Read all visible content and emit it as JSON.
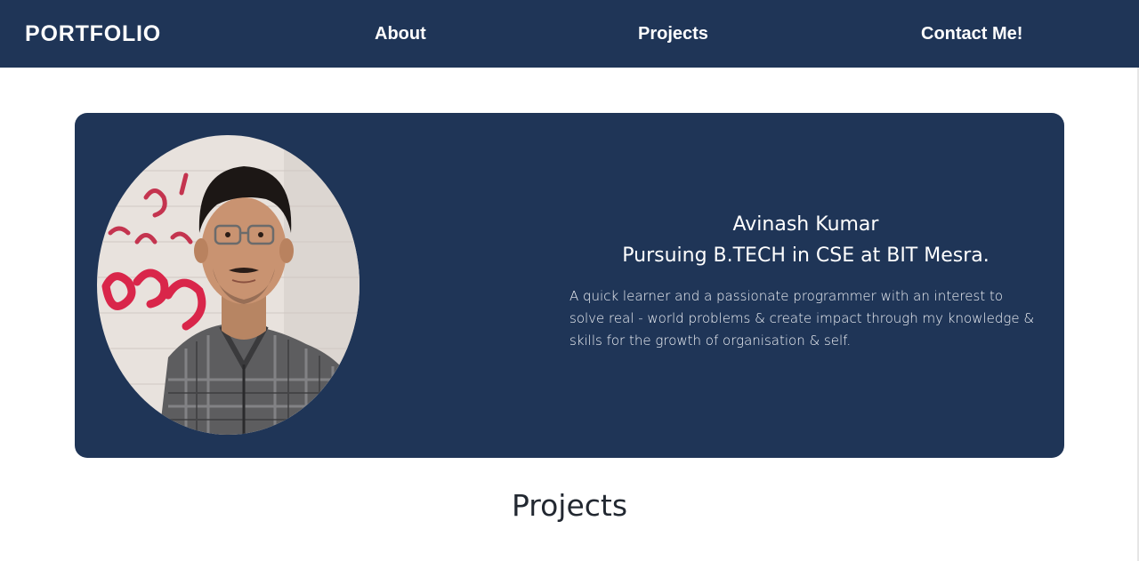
{
  "navbar": {
    "brand": "PORTFOLIO",
    "links": [
      {
        "label": "About"
      },
      {
        "label": "Projects"
      },
      {
        "label": "Contact Me!"
      }
    ],
    "background": "#1f3557"
  },
  "hero": {
    "name": "Avinash Kumar",
    "title": "Pursuing B.TECH in CSE at BIT Mesra.",
    "bio": "A quick learner and a passionate programmer with an interest to solve real - world problems & create impact through my knowledge & skills for the growth of organisation & self.",
    "avatar_icon": "profile-photo",
    "background": "#1f3557"
  },
  "projects": {
    "heading": "Projects"
  }
}
